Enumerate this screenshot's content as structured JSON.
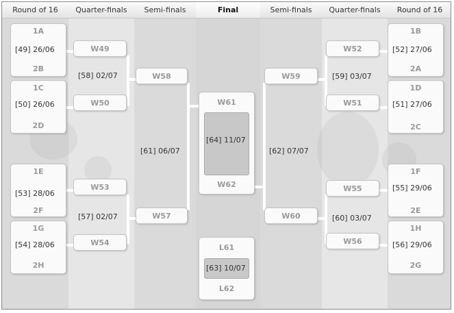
{
  "headers": {
    "r16_left": "Round of 16",
    "qf_left": "Quarter-finals",
    "sf_left": "Semi-finals",
    "final": "Final",
    "sf_right": "Semi-finals",
    "qf_right": "Quarter-finals",
    "r16_right": "Round of 16"
  },
  "round_of_16": {
    "m49": {
      "home": "1A",
      "away": "2B",
      "date": "[49] 26/06"
    },
    "m50": {
      "home": "1C",
      "away": "2D",
      "date": "[50] 26/06"
    },
    "m53": {
      "home": "1E",
      "away": "2F",
      "date": "[53] 28/06"
    },
    "m54": {
      "home": "1G",
      "away": "2H",
      "date": "[54] 28/06"
    },
    "m52": {
      "home": "1B",
      "away": "2A",
      "date": "[52] 27/06"
    },
    "m51": {
      "home": "1D",
      "away": "2C",
      "date": "[51] 27/06"
    },
    "m55": {
      "home": "1F",
      "away": "2E",
      "date": "[55] 29/06"
    },
    "m56": {
      "home": "1H",
      "away": "2G",
      "date": "[56] 29/06"
    }
  },
  "quarter_finals": {
    "m58": {
      "home": "W49",
      "away": "W50",
      "date": "[58] 02/07"
    },
    "m57": {
      "home": "W53",
      "away": "W54",
      "date": "[57] 02/07"
    },
    "m59": {
      "home": "W52",
      "away": "W51",
      "date": "[59] 03/07"
    },
    "m60": {
      "home": "W55",
      "away": "W56",
      "date": "[60] 03/07"
    }
  },
  "semi_finals": {
    "m61": {
      "home": "W58",
      "away": "W57",
      "date": "[61] 06/07"
    },
    "m62": {
      "home": "W59",
      "away": "W60",
      "date": "[62] 07/07"
    }
  },
  "final": {
    "home": "W61",
    "away": "W62",
    "date": "[64] 11/07"
  },
  "third_place": {
    "home": "L61",
    "away": "L62",
    "date": "[63] 10/07"
  },
  "colors": {
    "panel": "#fafafa",
    "team_label": "#999999",
    "date_text": "#333333",
    "connector": "#ffffff"
  }
}
